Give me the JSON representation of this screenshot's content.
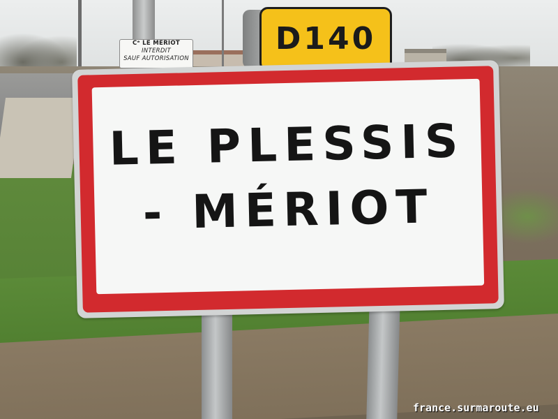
{
  "route_sign": {
    "text": "D140",
    "color": "#f5c11a"
  },
  "small_sign": {
    "lines": [
      "Cᵉ LE MERIOT",
      "INTERDIT",
      "SAUF AUTORISATION"
    ]
  },
  "town_sign": {
    "line1": "LE PLESSIS",
    "line2": "- MÉRIOT",
    "border_color": "#d22a2e"
  },
  "watermark": "france.surmaroute.eu"
}
